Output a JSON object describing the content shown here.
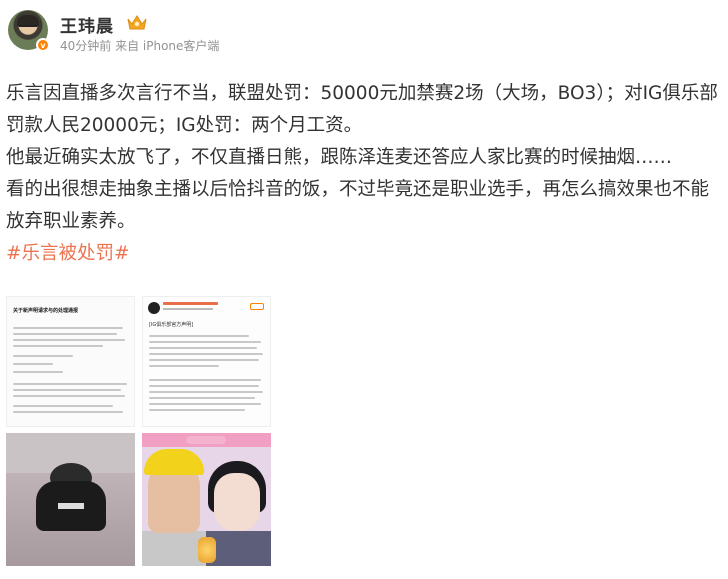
{
  "post": {
    "author": "王玮晨",
    "meta": "40分钟前 来自 iPhone客户端",
    "verified_badge": "v",
    "paragraphs": [
      "乐言因直播多次言行不当，联盟处罚：50000元加禁赛2场（大场，BO3）；对IG俱乐部罚款人民20000元；IG处罚：两个月工资。",
      "他最近确实太放飞了，不仅直播日熊，跟陈泽连麦还答应人家比赛的时候抽烟……",
      "看的出很想走抽象主播以后恰抖音的饭，不过毕竟还是职业选手，再怎么搞效果也不能放弃职业素养。"
    ],
    "topic": "#乐言被处罚#"
  },
  "images": {
    "doc_title": "关于新声明请求与的处理通报",
    "weibo_repost_header": "[IG俱乐部官方声明]"
  },
  "colors": {
    "topic": "#eb7350",
    "meta": "#939393",
    "badge": "#ff8200"
  },
  "icons": {
    "crown": "crown-icon",
    "verified": "verified-badge-icon"
  }
}
